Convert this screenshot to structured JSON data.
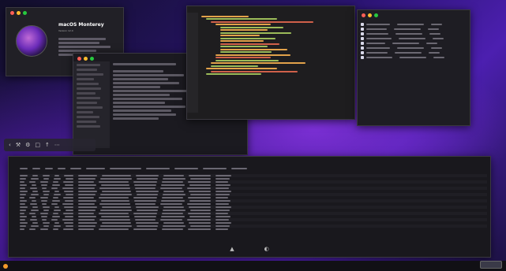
{
  "about": {
    "os_name": "macOS Monterey",
    "version": "Version 12.0"
  },
  "toolbar": {
    "icons": [
      "back-icon",
      "tools-icon",
      "gear-icon",
      "trash-icon",
      "share-icon",
      "more-icon"
    ]
  },
  "table": {
    "foot_left": "▲",
    "foot_right": "◐"
  },
  "colors": {
    "accent": "#7a2fd3",
    "code_green": "#9bbb59",
    "code_orange": "#e2a24a",
    "code_red": "#d0604a"
  }
}
